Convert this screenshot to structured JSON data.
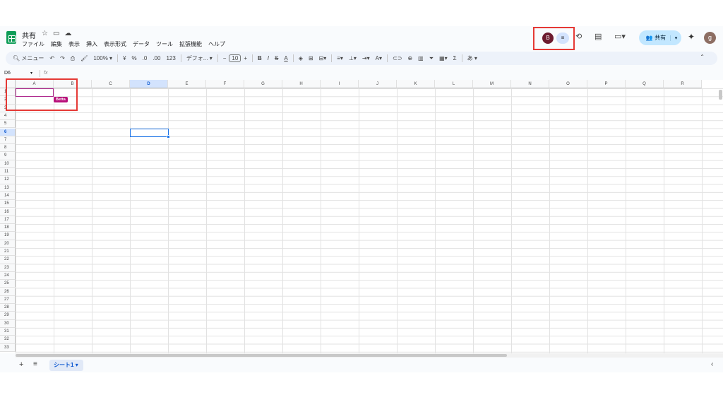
{
  "app": {
    "title": "共有",
    "title_icons": [
      "star-icon",
      "folder-icon",
      "cloud-icon"
    ],
    "menu": [
      "ファイル",
      "編集",
      "表示",
      "挿入",
      "表示形式",
      "データ",
      "ツール",
      "拡張機能",
      "ヘルプ"
    ]
  },
  "header_right": {
    "collaborator_avatar_letter": "B",
    "share_label": "共有",
    "user_avatar_letter": "g"
  },
  "toolbar": {
    "search_label": "メニュー",
    "zoom": "100%",
    "currency": "¥",
    "percent": "%",
    "decimal_decrease": ".0",
    "decimal_increase": ".00",
    "number_format": "123",
    "font_name": "デフォ...",
    "font_size": "10",
    "bold": "B",
    "italic": "I",
    "strike": "S",
    "text_color": "A",
    "sum": "Σ",
    "input_tools": "あ"
  },
  "formula_bar": {
    "name_box": "D6",
    "fx_label": "fx"
  },
  "grid": {
    "columns": [
      "A",
      "B",
      "C",
      "D",
      "E",
      "F",
      "G",
      "H",
      "I",
      "J",
      "K",
      "L",
      "M",
      "N",
      "O",
      "P",
      "Q",
      "R"
    ],
    "selected_column": "D",
    "rows": [
      "1",
      "2",
      "3",
      "4",
      "5",
      "6",
      "7",
      "8",
      "9",
      "10",
      "11",
      "12",
      "13",
      "14",
      "15",
      "16",
      "17",
      "18",
      "19",
      "20",
      "21",
      "22",
      "23",
      "24",
      "25",
      "26",
      "27",
      "28",
      "29",
      "30",
      "31",
      "32",
      "33"
    ],
    "selected_row": "6",
    "collaborator_tag": "Betta"
  },
  "sheets": {
    "active_tab": "シート1"
  },
  "colors": {
    "accent": "#0b57d0",
    "collaborator": "#b80f7a",
    "annotation": "#e53935"
  }
}
